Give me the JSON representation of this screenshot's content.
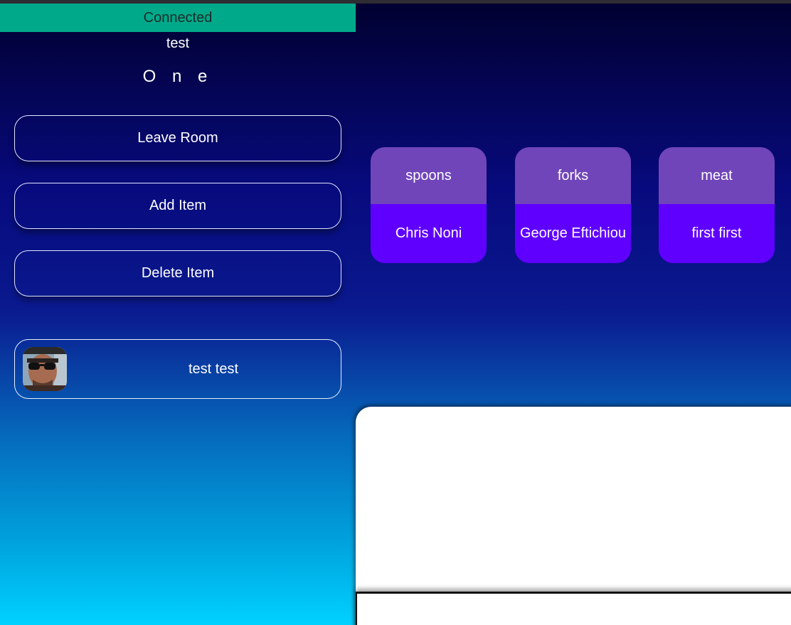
{
  "status": {
    "text": "Connected",
    "color": "#00a98a"
  },
  "user": {
    "name": "test"
  },
  "room": {
    "name": "O n e"
  },
  "sidebar": {
    "buttons": [
      {
        "label": "Leave Room"
      },
      {
        "label": "Add Item"
      },
      {
        "label": "Delete Item"
      }
    ]
  },
  "members": [
    {
      "name": "test test",
      "avatar": "user-photo"
    }
  ],
  "items": [
    {
      "title": "spoons",
      "assignee": "Chris Noni"
    },
    {
      "title": "forks",
      "assignee": "George Eftichiou"
    },
    {
      "title": "meat",
      "assignee": "first first"
    }
  ],
  "colors": {
    "item_header": "#7045b9",
    "item_body": "#5f00ff",
    "gradient_top": "#01002f",
    "gradient_bottom": "#00d2ff"
  }
}
